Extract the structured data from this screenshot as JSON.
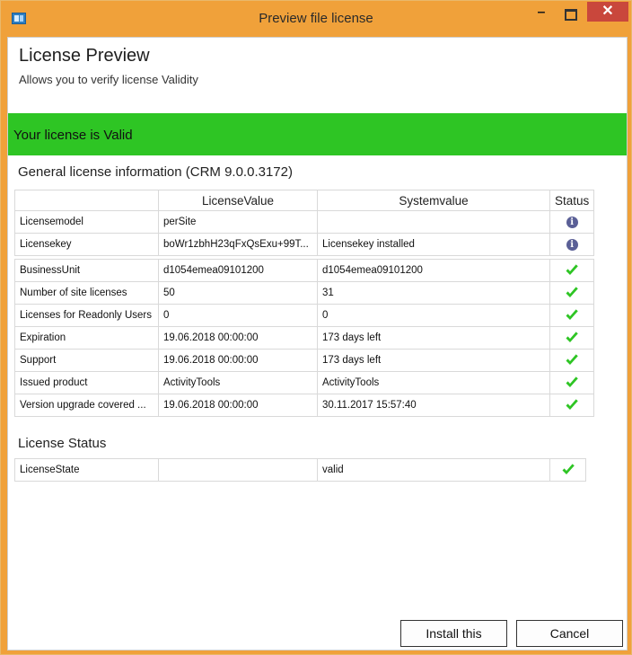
{
  "window": {
    "title": "Preview file license"
  },
  "header": {
    "title": "License Preview",
    "subtitle": "Allows you to verify license Validity"
  },
  "banner": {
    "text": "Your license is Valid",
    "color": "#2ec524"
  },
  "general": {
    "title": "General license information (CRM 9.0.0.3172)",
    "columns": [
      "",
      "LicenseValue",
      "Systemvalue",
      "Status"
    ],
    "rows_group1": [
      {
        "name": "Licensemodel",
        "license": "perSite",
        "system": "",
        "status": "info"
      },
      {
        "name": "Licensekey",
        "license": "boWr1zbhH23qFxQsExu+99T...",
        "system": "Licensekey installed",
        "status": "info"
      }
    ],
    "rows_group2": [
      {
        "name": "BusinessUnit",
        "license": "d1054emea09101200",
        "system": "d1054emea09101200",
        "status": "check"
      },
      {
        "name": "Number of site licenses",
        "license": "50",
        "system": "31",
        "status": "check"
      },
      {
        "name": "Licenses for Readonly Users",
        "license": "0",
        "system": "0",
        "status": "check"
      },
      {
        "name": "Expiration",
        "license": "19.06.2018 00:00:00",
        "system": "173 days left",
        "status": "check"
      },
      {
        "name": "Support",
        "license": "19.06.2018 00:00:00",
        "system": "173 days left",
        "status": "check"
      },
      {
        "name": "Issued product",
        "license": "ActivityTools",
        "system": "ActivityTools",
        "status": "check"
      },
      {
        "name": "Version upgrade covered ...",
        "license": "19.06.2018 00:00:00",
        "system": "30.11.2017 15:57:40",
        "status": "check"
      }
    ]
  },
  "license_status": {
    "title": "License Status",
    "rows": [
      {
        "name": "LicenseState",
        "license": "",
        "system": "valid",
        "status": "check"
      }
    ]
  },
  "buttons": {
    "install": "Install this",
    "cancel": "Cancel"
  },
  "icons": {
    "info": "info-icon",
    "check": "check-icon"
  }
}
